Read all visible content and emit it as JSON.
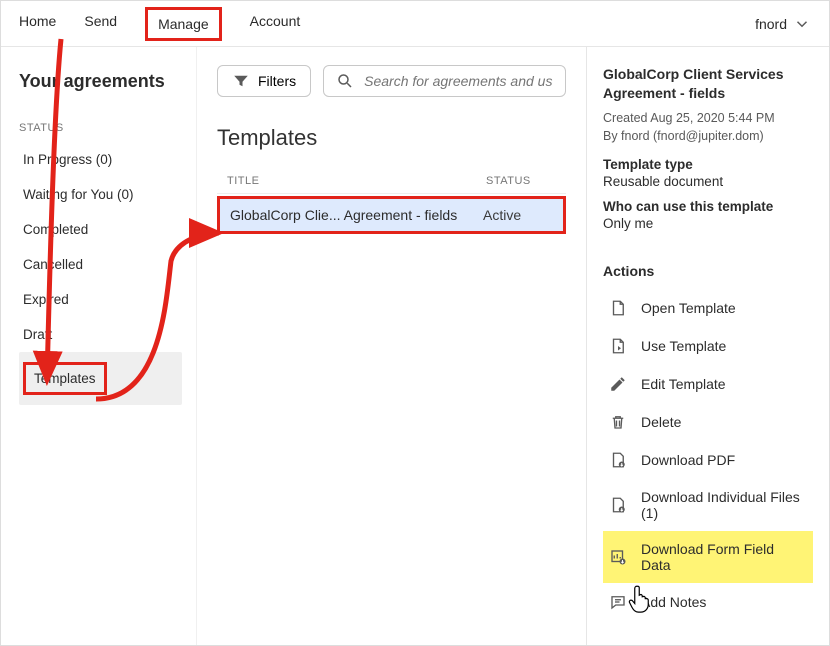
{
  "nav": {
    "home": "Home",
    "send": "Send",
    "manage": "Manage",
    "account": "Account",
    "user": "fnord"
  },
  "sidebar": {
    "heading": "Your agreements",
    "status_label": "STATUS",
    "items": [
      "In Progress (0)",
      "Waiting for You (0)",
      "Completed",
      "Cancelled",
      "Expired",
      "Draft"
    ],
    "templates": "Templates"
  },
  "main": {
    "filters_label": "Filters",
    "search_placeholder": "Search for agreements and users...",
    "heading": "Templates",
    "col_title": "TITLE",
    "col_status": "STATUS",
    "row": {
      "title": "GlobalCorp Clie...  Agreement - fields",
      "status": "Active"
    }
  },
  "panel": {
    "title": "GlobalCorp Client Services Agreement - fields",
    "created": "Created Aug 25, 2020 5:44 PM",
    "by": "By fnord (fnord@jupiter.dom)",
    "type_label": "Template type",
    "type_value": "Reusable document",
    "who_label": "Who can use this template",
    "who_value": "Only me",
    "actions_label": "Actions",
    "actions": {
      "open": "Open Template",
      "use": "Use Template",
      "edit": "Edit Template",
      "delete": "Delete",
      "dl_pdf": "Download PDF",
      "dl_files": "Download Individual Files (1)",
      "dl_form": "Download Form Field Data",
      "notes": "Add Notes"
    }
  }
}
